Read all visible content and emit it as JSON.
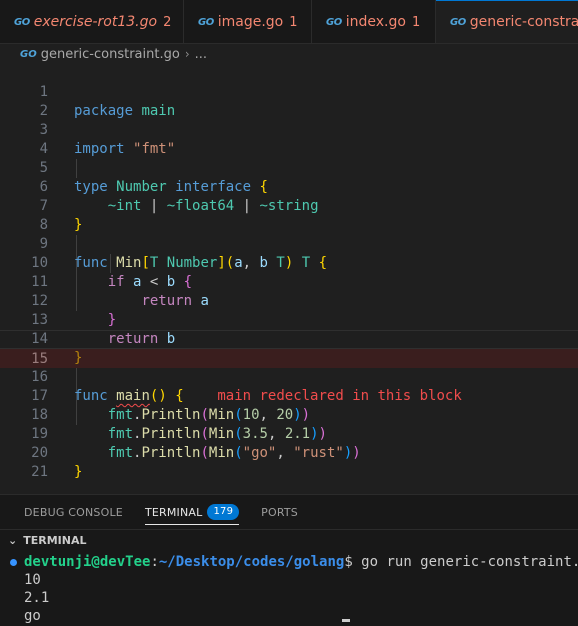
{
  "tabs": [
    {
      "title": "exercise-rot13.go",
      "count": "2",
      "icon": "go-file-icon"
    },
    {
      "title": "image.go",
      "count": "1",
      "icon": "go-file-icon"
    },
    {
      "title": "index.go",
      "count": "1",
      "icon": "go-file-icon"
    },
    {
      "title": "generic-constraint.go",
      "count": "",
      "icon": "go-file-icon"
    }
  ],
  "icon_label": "GO",
  "breadcrumb": {
    "file": "generic-constraint.go",
    "more": "..."
  },
  "editor": {
    "line_numbers": [
      "1",
      "2",
      "3",
      "4",
      "5",
      "6",
      "7",
      "8",
      "9",
      "10",
      "11",
      "12",
      "13",
      "14",
      "15",
      "16",
      "17",
      "18",
      "19",
      "20",
      "21"
    ],
    "current_line": "15",
    "tokens": {
      "package": "package",
      "main": "main",
      "import": "import",
      "fmt_str": "\"fmt\"",
      "type": "type",
      "Number": "Number",
      "interface": "interface",
      "tilde_int": "~int",
      "pipe": "|",
      "tilde_float64": "~float64",
      "tilde_string": "~string",
      "func": "func",
      "Min": "Min",
      "T": "T",
      "a": "a",
      "b": "b",
      "if": "if",
      "lt": "<",
      "return": "return",
      "open_brace": "{",
      "close_brace": "}",
      "open_bracket": "[",
      "close_bracket": "]",
      "open_paren": "(",
      "close_paren": ")",
      "comma": ",",
      "fmt": "fmt",
      "Println": "Println",
      "dot": ".",
      "n10": "10",
      "n20": "20",
      "n35": "3.5",
      "n21": "2.1",
      "go_str": "\"go\"",
      "rust_str": "\"rust\""
    },
    "error_message": "main redeclared in this block"
  },
  "panel": {
    "tabs": [
      {
        "label": "DEBUG CONSOLE"
      },
      {
        "label": "TERMINAL",
        "badge": "179"
      },
      {
        "label": "PORTS"
      }
    ],
    "section_title": "TERMINAL",
    "terminal": {
      "user": "devtunji@devTee",
      "colon": ":",
      "path": "~/Desktop/codes/golang",
      "command": "$ go run generic-constraint.go",
      "output": [
        "10",
        "2.1",
        "go"
      ]
    }
  },
  "colors": {
    "accent": "#0078d4",
    "error": "#f14c4c",
    "tab_error_text": "#f48771"
  }
}
